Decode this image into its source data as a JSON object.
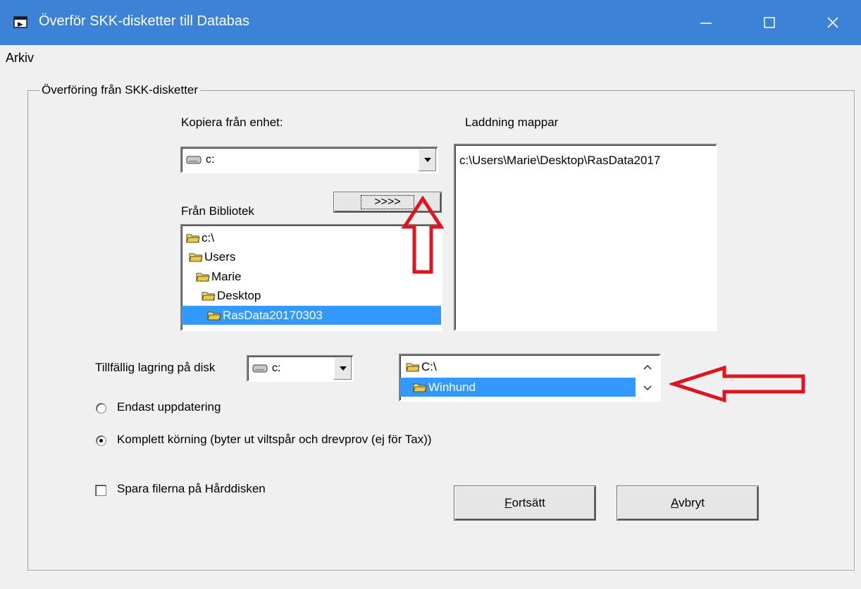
{
  "window": {
    "title": "Överför SKK-disketter till Databas",
    "accent": "#3c82d6"
  },
  "menu": {
    "arkiv": "Arkiv"
  },
  "group": {
    "legend": "Överföring från SKK-disketter"
  },
  "copy_from": {
    "label": "Kopiera från enhet:",
    "value": "c:"
  },
  "from_library": {
    "label": "Från Bibliotek",
    "items": [
      {
        "label": "c:\\"
      },
      {
        "label": "Users"
      },
      {
        "label": "Marie"
      },
      {
        "label": "Desktop"
      },
      {
        "label": "RasData20170303",
        "selected": true
      }
    ]
  },
  "transfer_button": {
    "label": ">>>>"
  },
  "load_folders": {
    "label": "Laddning mappar",
    "items": [
      "c:\\Users\\Marie\\Desktop\\RasData2017"
    ]
  },
  "temp_storage": {
    "label": "Tillfällig lagring på disk",
    "drive_value": "c:",
    "items": [
      {
        "label": "C:\\"
      },
      {
        "label": "Winhund",
        "selected": true
      }
    ]
  },
  "options": {
    "only_update": "Endast uppdatering",
    "full_run": "Komplett körning (byter ut viltspår och drevprov (ej för Tax))",
    "full_run_checked": true,
    "save_to_disk": "Spara filerna på Hårddisken",
    "save_checked": false
  },
  "buttons": {
    "continue": "Fortsätt",
    "cancel": "Avbryt"
  },
  "annotation_color": "#e0141e"
}
